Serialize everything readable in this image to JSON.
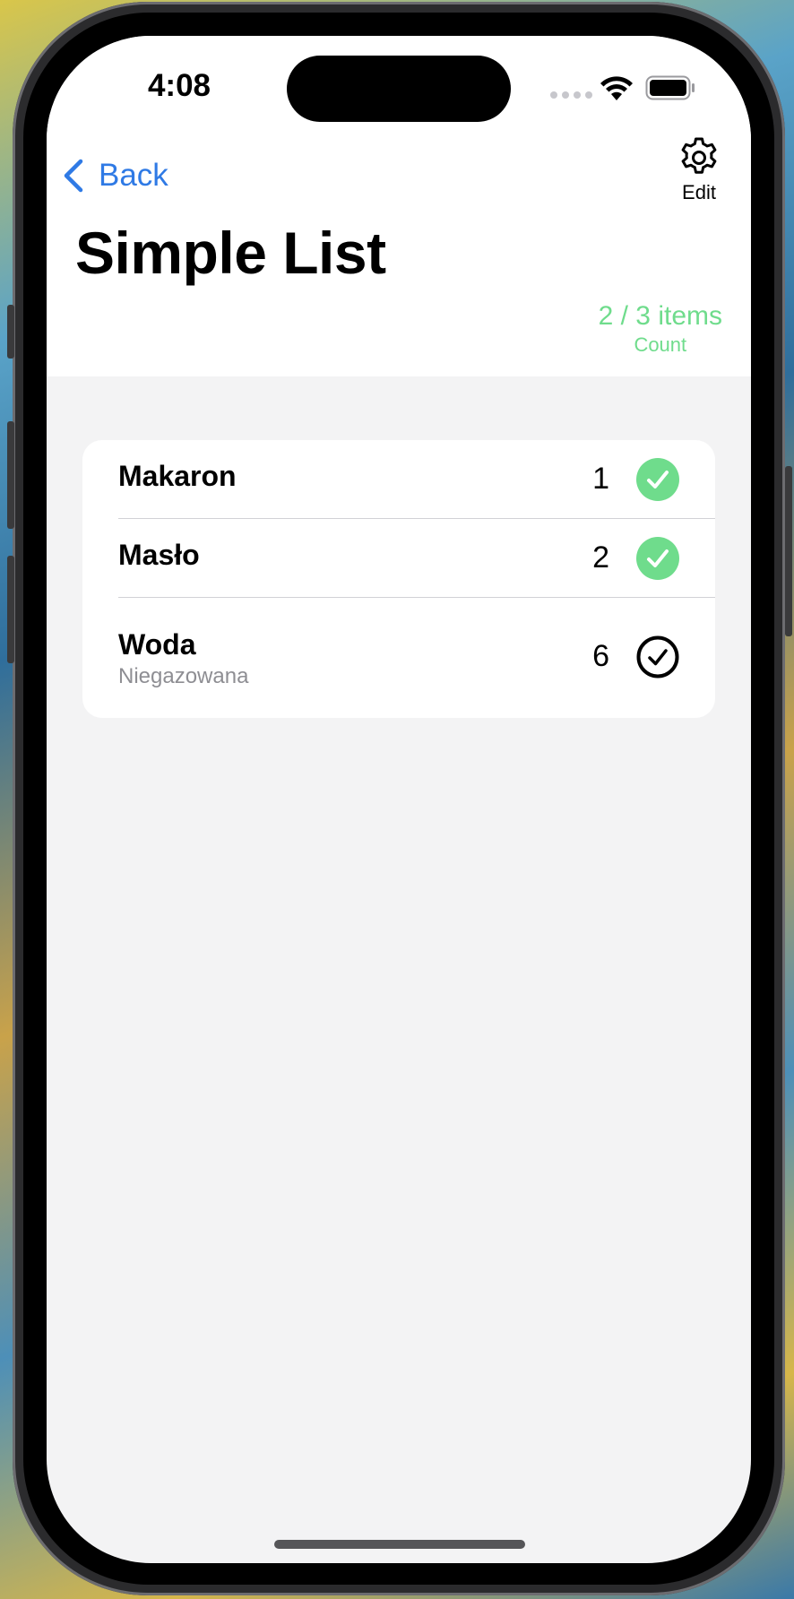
{
  "status_bar": {
    "time": "4:08"
  },
  "nav": {
    "back_label": "Back",
    "edit_label": "Edit",
    "accent_color": "#2f7ae5"
  },
  "page": {
    "title": "Simple List"
  },
  "count": {
    "value": "2 / 3 items",
    "label": "Count",
    "color": "#6fdc8c"
  },
  "items": [
    {
      "title": "Makaron",
      "subtitle": "",
      "quantity": "1",
      "checked": true
    },
    {
      "title": "Masło",
      "subtitle": "",
      "quantity": "2",
      "checked": true
    },
    {
      "title": "Woda",
      "subtitle": "Niegazowana",
      "quantity": "6",
      "checked": false
    }
  ],
  "icons": {
    "back": "chevron-left-icon",
    "edit": "gear-icon",
    "checked": "checkmark-circle-filled-icon",
    "unchecked": "checkmark-circle-outline-icon"
  }
}
